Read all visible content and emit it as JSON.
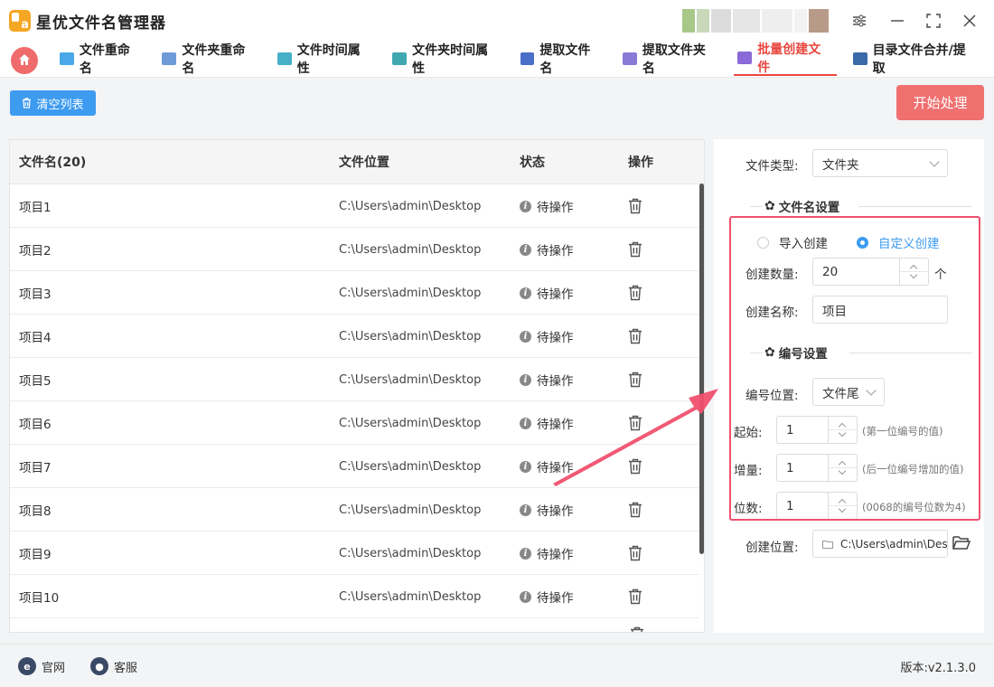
{
  "app": {
    "title": "星优文件名管理器"
  },
  "window_controls": [
    "settings-sliders",
    "minimize",
    "maximize",
    "close"
  ],
  "tabs": [
    {
      "label": "文件重命名",
      "icon": "file-rename-icon",
      "color": "#4aa8e8",
      "active": false
    },
    {
      "label": "文件夹重命名",
      "icon": "folder-rename-icon",
      "color": "#6f9ad8",
      "active": false
    },
    {
      "label": "文件时间属性",
      "icon": "file-time-icon",
      "color": "#46b0c8",
      "active": false
    },
    {
      "label": "文件夹时间属性",
      "icon": "folder-time-icon",
      "color": "#3fa8b0",
      "active": false
    },
    {
      "label": "提取文件名",
      "icon": "extract-filename-icon",
      "color": "#4a6fc8",
      "active": false
    },
    {
      "label": "提取文件夹名",
      "icon": "extract-foldername-icon",
      "color": "#8a7ad8",
      "active": false
    },
    {
      "label": "批量创建文件",
      "icon": "batch-create-icon",
      "color": "#8a6ad8",
      "active": true
    },
    {
      "label": "目录文件合并/提取",
      "icon": "merge-extract-icon",
      "color": "#3a6aa8",
      "active": false
    }
  ],
  "toolbar": {
    "clear_label": "清空列表",
    "start_label": "开始处理"
  },
  "table": {
    "headers": [
      "文件名(20)",
      "文件位置",
      "状态",
      "操作"
    ],
    "rows": [
      {
        "name": "项目1",
        "path": "C:\\Users\\admin\\Desktop",
        "status": "待操作"
      },
      {
        "name": "项目2",
        "path": "C:\\Users\\admin\\Desktop",
        "status": "待操作"
      },
      {
        "name": "项目3",
        "path": "C:\\Users\\admin\\Desktop",
        "status": "待操作"
      },
      {
        "name": "项目4",
        "path": "C:\\Users\\admin\\Desktop",
        "status": "待操作"
      },
      {
        "name": "项目5",
        "path": "C:\\Users\\admin\\Desktop",
        "status": "待操作"
      },
      {
        "name": "项目6",
        "path": "C:\\Users\\admin\\Desktop",
        "status": "待操作"
      },
      {
        "name": "项目7",
        "path": "C:\\Users\\admin\\Desktop",
        "status": "待操作"
      },
      {
        "name": "项目8",
        "path": "C:\\Users\\admin\\Desktop",
        "status": "待操作"
      },
      {
        "name": "项目9",
        "path": "C:\\Users\\admin\\Desktop",
        "status": "待操作"
      },
      {
        "name": "项目10",
        "path": "C:\\Users\\admin\\Desktop",
        "status": "待操作"
      }
    ]
  },
  "settings": {
    "file_type_label": "文件类型:",
    "file_type_value": "文件夹",
    "filename_section": "文件名设置",
    "radio_import": "导入创建",
    "radio_custom": "自定义创建",
    "count_label": "创建数量:",
    "count_value": "20",
    "count_unit": "个",
    "name_label": "创建名称:",
    "name_value": "项目",
    "numbering_section": "编号设置",
    "position_label": "编号位置:",
    "position_value": "文件尾",
    "start_label": "起始:",
    "start_value": "1",
    "start_hint": "(第一位编号的值)",
    "step_label": "增量:",
    "step_value": "1",
    "step_hint": "(后一位编号增加的值)",
    "digits_label": "位数:",
    "digits_value": "1",
    "digits_hint": "(0068的编号位数为4)",
    "location_label": "创建位置:",
    "location_value": "C:\\Users\\admin\\Des"
  },
  "footer": {
    "website_label": "官网",
    "support_label": "客服",
    "version": "版本:v2.1.3.0"
  },
  "colors": {
    "accent_red": "#e8473f",
    "start_button": "#f07070",
    "clear_button": "#3d9bf0",
    "highlight_border": "#f0506e",
    "annotation_arrow": "#f0506e"
  }
}
